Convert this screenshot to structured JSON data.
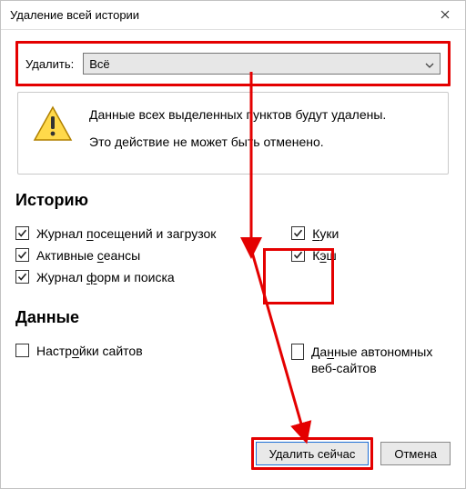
{
  "window": {
    "title": "Удаление всей истории"
  },
  "range": {
    "label": "Удалить:",
    "selected": "Всё"
  },
  "warning": {
    "line1": "Данные всех выделенных пунктов будут удалены.",
    "line2": "Это действие не может быть отменено."
  },
  "sections": {
    "history_title": "Историю",
    "data_title": "Данные"
  },
  "checks": {
    "browsing_downloads": {
      "label_pre": "Журнал ",
      "label_u": "п",
      "label_post": "осещений и загрузок",
      "checked": true
    },
    "active_sessions": {
      "label_pre": "Активные ",
      "label_u": "с",
      "label_post": "еансы",
      "checked": true
    },
    "forms_search": {
      "label_pre": "Журнал ",
      "label_u": "ф",
      "label_post": "орм и поиска",
      "checked": true
    },
    "cookies": {
      "label_u": "К",
      "label_post": "уки",
      "checked": true
    },
    "cache": {
      "label_pre": "К",
      "label_u": "э",
      "label_post": "ш",
      "checked": true
    },
    "site_settings": {
      "label_pre": "Настр",
      "label_u": "о",
      "label_post": "йки сайтов",
      "checked": false
    },
    "offline_sites": {
      "label_pre": "Да",
      "label_u": "н",
      "label_post": "ные автономных веб-сайтов",
      "checked": false
    }
  },
  "buttons": {
    "delete_now": "Удалить сейчас",
    "cancel": "Отмена"
  }
}
